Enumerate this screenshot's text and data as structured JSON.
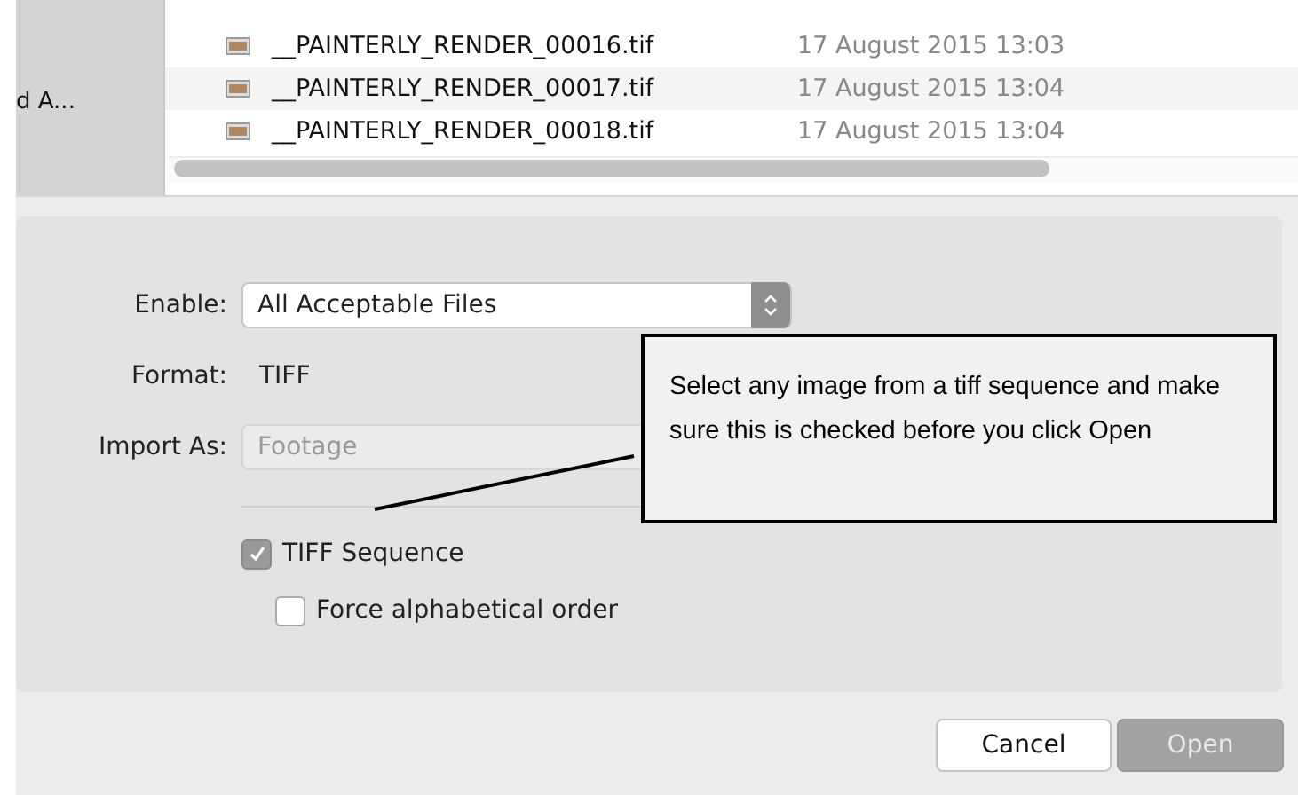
{
  "sidebar": {
    "items": [
      {
        "label": "d A..."
      }
    ]
  },
  "files": [
    {
      "name": "__PAINTERLY_RENDER_00016.tif",
      "date": "17 August 2015 13:03"
    },
    {
      "name": "__PAINTERLY_RENDER_00017.tif",
      "date": "17 August 2015 13:04"
    },
    {
      "name": "__PAINTERLY_RENDER_00018.tif",
      "date": "17 August 2015 13:04"
    }
  ],
  "options": {
    "enable": {
      "label": "Enable:",
      "value": "All Acceptable Files"
    },
    "format": {
      "label": "Format:",
      "value": "TIFF"
    },
    "import_as": {
      "label": "Import As:",
      "value": "Footage",
      "disabled": true
    },
    "checkboxes": [
      {
        "label": "TIFF Sequence",
        "checked": true,
        "disabled": true,
        "nested": false
      },
      {
        "label": "Force alphabetical order",
        "checked": false,
        "disabled": false,
        "nested": true
      }
    ]
  },
  "annotation": {
    "text": "Select any image from a tiff sequence and make sure this is checked before you click Open"
  },
  "buttons": [
    {
      "label": "Cancel",
      "disabled": false
    },
    {
      "label": "Open",
      "disabled": true
    }
  ]
}
